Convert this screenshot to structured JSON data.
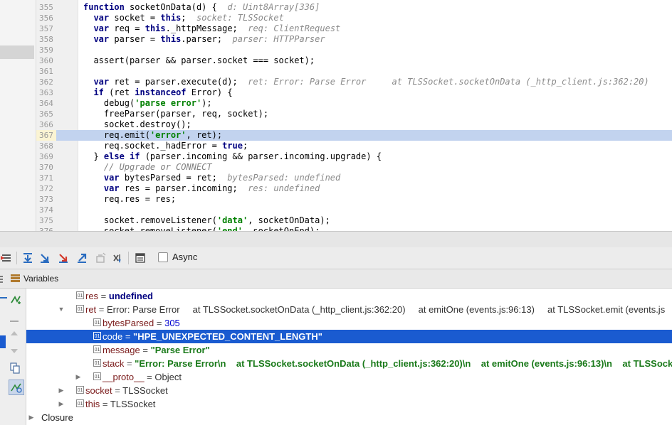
{
  "editor": {
    "lines": [
      {
        "num": "355",
        "tokens": [
          [
            "k",
            "function "
          ],
          [
            "p",
            "socketOnData(d) {  "
          ],
          [
            "h",
            "d: Uint8Array[336]"
          ]
        ]
      },
      {
        "num": "356",
        "tokens": [
          [
            "p",
            "  "
          ],
          [
            "k",
            "var "
          ],
          [
            "p",
            "socket = "
          ],
          [
            "k",
            "this"
          ],
          [
            "p",
            ";  "
          ],
          [
            "h",
            "socket: TLSSocket"
          ]
        ]
      },
      {
        "num": "357",
        "tokens": [
          [
            "p",
            "  "
          ],
          [
            "k",
            "var "
          ],
          [
            "p",
            "req = "
          ],
          [
            "k",
            "this"
          ],
          [
            "p",
            "._httpMessage;  "
          ],
          [
            "h",
            "req: ClientRequest"
          ]
        ]
      },
      {
        "num": "358",
        "tokens": [
          [
            "p",
            "  "
          ],
          [
            "k",
            "var "
          ],
          [
            "p",
            "parser = "
          ],
          [
            "k",
            "this"
          ],
          [
            "p",
            ".parser;  "
          ],
          [
            "h",
            "parser: HTTPParser"
          ]
        ]
      },
      {
        "num": "359",
        "tokens": []
      },
      {
        "num": "360",
        "tokens": [
          [
            "p",
            "  assert(parser && parser.socket === socket);"
          ]
        ]
      },
      {
        "num": "361",
        "tokens": []
      },
      {
        "num": "362",
        "tokens": [
          [
            "p",
            "  "
          ],
          [
            "k",
            "var "
          ],
          [
            "p",
            "ret = parser.execute(d);  "
          ],
          [
            "h",
            "ret: Error: Parse Error     at TLSSocket.socketOnData (_http_client.js:362:20)     at emitOne"
          ]
        ]
      },
      {
        "num": "363",
        "tokens": [
          [
            "p",
            "  "
          ],
          [
            "k",
            "if "
          ],
          [
            "p",
            "(ret "
          ],
          [
            "k",
            "instanceof "
          ],
          [
            "p",
            "Error) {"
          ]
        ]
      },
      {
        "num": "364",
        "tokens": [
          [
            "p",
            "    debug("
          ],
          [
            "s",
            "'parse error'"
          ],
          [
            "p",
            ");"
          ]
        ]
      },
      {
        "num": "365",
        "tokens": [
          [
            "p",
            "    freeParser(parser, req, socket);"
          ]
        ]
      },
      {
        "num": "366",
        "tokens": [
          [
            "p",
            "    socket.destroy();"
          ]
        ]
      },
      {
        "num": "367",
        "highlight": true,
        "tokens": [
          [
            "p",
            "    req.emit("
          ],
          [
            "s",
            "'error'"
          ],
          [
            "p",
            ", ret);"
          ]
        ]
      },
      {
        "num": "368",
        "tokens": [
          [
            "p",
            "    req.socket._hadError = "
          ],
          [
            "k",
            "true"
          ],
          [
            "p",
            ";"
          ]
        ]
      },
      {
        "num": "369",
        "tokens": [
          [
            "p",
            "  } "
          ],
          [
            "k",
            "else if "
          ],
          [
            "p",
            "(parser.incoming && parser.incoming.upgrade) {"
          ]
        ]
      },
      {
        "num": "370",
        "tokens": [
          [
            "p",
            "    "
          ],
          [
            "c",
            "// Upgrade or CONNECT"
          ]
        ]
      },
      {
        "num": "371",
        "tokens": [
          [
            "p",
            "    "
          ],
          [
            "k",
            "var "
          ],
          [
            "p",
            "bytesParsed = ret;  "
          ],
          [
            "h",
            "bytesParsed: undefined"
          ]
        ]
      },
      {
        "num": "372",
        "tokens": [
          [
            "p",
            "    "
          ],
          [
            "k",
            "var "
          ],
          [
            "p",
            "res = parser.incoming;  "
          ],
          [
            "h",
            "res: undefined"
          ]
        ]
      },
      {
        "num": "373",
        "tokens": [
          [
            "p",
            "    req.res = res;"
          ]
        ]
      },
      {
        "num": "374",
        "tokens": []
      },
      {
        "num": "375",
        "tokens": [
          [
            "p",
            "    socket.removeListener("
          ],
          [
            "s",
            "'data'"
          ],
          [
            "p",
            ", socketOnData);"
          ]
        ]
      },
      {
        "num": "376",
        "tokens": [
          [
            "p",
            "    socket.removeListener("
          ],
          [
            "s",
            "'end'"
          ],
          [
            "p",
            ", socketOnEnd);"
          ]
        ]
      }
    ]
  },
  "toolbar": {
    "async_label": "Async",
    "icons": [
      "show-execution-point-icon",
      "step-over-icon",
      "step-into-icon",
      "force-step-into-icon",
      "step-out-icon",
      "drop-frame-icon",
      "run-to-cursor-icon",
      "evaluate-expression-icon"
    ]
  },
  "variables": {
    "title": "Variables",
    "rows": [
      {
        "name": "res",
        "eq": " = ",
        "value": "undefined",
        "vclass": "kw",
        "indent": 1,
        "tri": "",
        "icon": true
      },
      {
        "name": "ret",
        "eq": " = ",
        "value": "Error: Parse Error     at TLSSocket.socketOnData (_http_client.js:362:20)     at emitOne (events.js:96:13)     at TLSSocket.emit (events.js",
        "vclass": "",
        "indent": 1,
        "tri": "down",
        "icon": true
      },
      {
        "name": "bytesParsed",
        "eq": " = ",
        "value": "305",
        "vclass": "num",
        "indent": 2,
        "tri": "",
        "icon": true
      },
      {
        "name": "code",
        "eq": " = ",
        "value": "\"HPE_UNEXPECTED_CONTENT_LENGTH\"",
        "vclass": "str",
        "indent": 2,
        "tri": "",
        "icon": true,
        "selected": true
      },
      {
        "name": "message",
        "eq": " = ",
        "value": "\"Parse Error\"",
        "vclass": "str",
        "indent": 2,
        "tri": "",
        "icon": true
      },
      {
        "name": "stack",
        "eq": " = ",
        "value": "\"Error: Parse Error\\n    at TLSSocket.socketOnData (_http_client.js:362:20)\\n    at emitOne (events.js:96:13)\\n    at TLSSocket.emit",
        "vclass": "str",
        "indent": 2,
        "tri": "",
        "icon": true
      },
      {
        "name": "__proto__",
        "eq": " = ",
        "value": "Object",
        "vclass": "",
        "indent": 2,
        "tri": "right",
        "icon": true
      },
      {
        "name": "socket",
        "eq": " = ",
        "value": "TLSSocket",
        "vclass": "",
        "indent": 1,
        "tri": "right",
        "icon": true
      },
      {
        "name": "this",
        "eq": " = ",
        "value": "TLSSocket",
        "vclass": "",
        "indent": 1,
        "tri": "right",
        "icon": true
      },
      {
        "name": "Closure",
        "eq": "",
        "value": "",
        "vclass": "",
        "indent": 0,
        "tri": "right",
        "icon": false
      }
    ]
  }
}
